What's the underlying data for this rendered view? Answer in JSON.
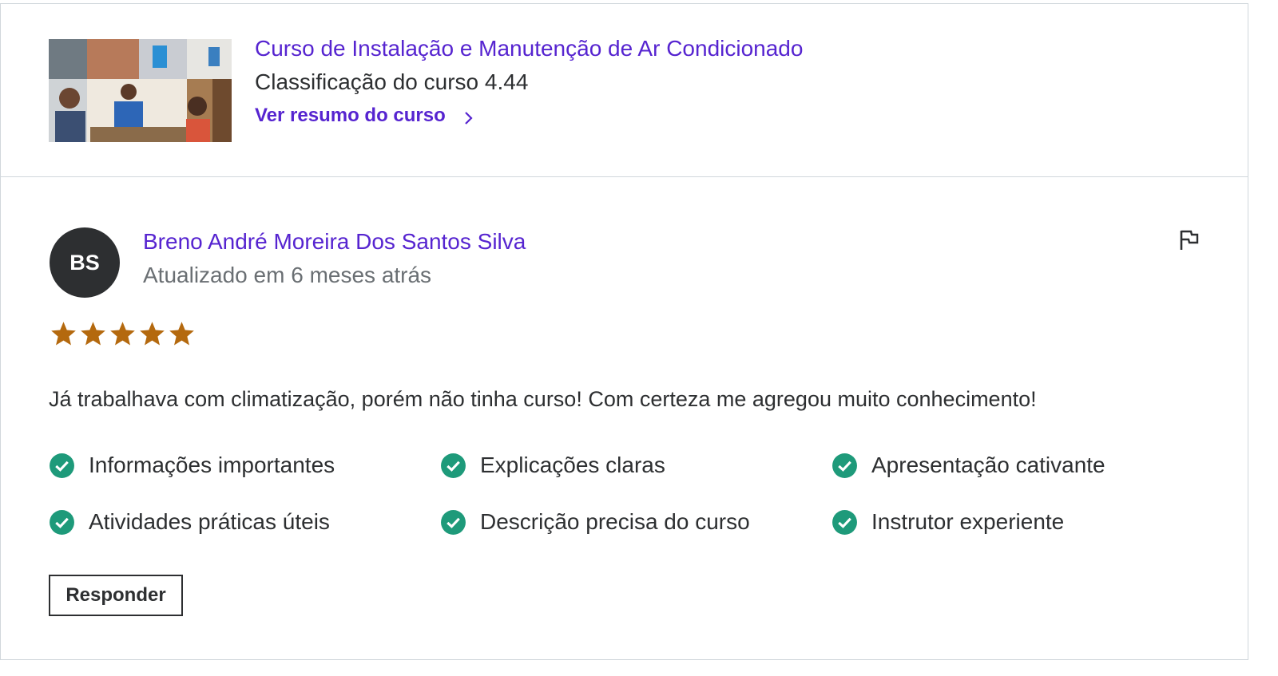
{
  "course": {
    "title": "Curso de Instalação e Manutenção de Ar Condicionado",
    "rating_text": "Classificação do curso 4.44",
    "link_label": "Ver resumo do curso"
  },
  "review": {
    "avatar_initials": "BS",
    "reviewer_name": "Breno André Moreira Dos Santos Silva",
    "updated": "Atualizado em 6 meses atrás",
    "stars": 5,
    "comment": "Já trabalhava com climatização, porém não tinha curso! Com certeza me agregou muito conhecimento!",
    "tags": [
      "Informações importantes",
      "Explicações claras",
      "Apresentação cativante",
      "Atividades práticas úteis",
      "Descrição precisa do curso",
      "Instrutor experiente"
    ],
    "reply_label": "Responder"
  },
  "colors": {
    "brand_purple": "#5624d0",
    "star": "#b4690e",
    "check": "#1e9a7a",
    "text": "#2d2f31",
    "muted": "#6a6f73"
  },
  "icons": [
    "chevron-right-icon",
    "flag-icon",
    "star-icon",
    "check-circle-icon"
  ]
}
